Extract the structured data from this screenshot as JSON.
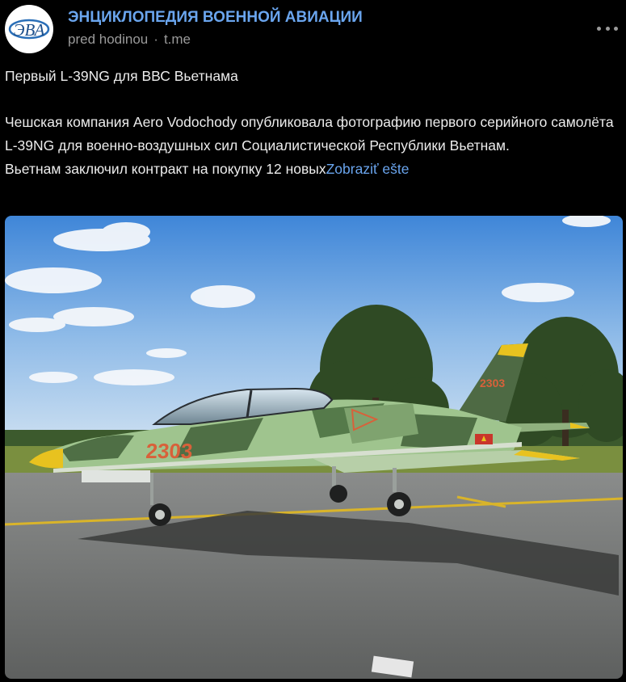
{
  "channel": {
    "name": "ЭНЦИКЛОПЕДИЯ ВОЕННОЙ АВИАЦИИ",
    "time": "pred hodinou",
    "separator": "·",
    "source": "t.me",
    "avatar_text": "ЭВА"
  },
  "post": {
    "title": "Первый L-39NG для ВВС Вьетнама",
    "body": "Чешская компания Aero Vodochody опубликовала фотографию первого серийного самолёта L-39NG для военно-воздушных сил Социалистической Республики Вьетнам.",
    "teaser": "Вьетнам заключил контракт на покупку 12 новых",
    "more_link": "Zobraziť ešte"
  },
  "photo": {
    "tail_number": "2303",
    "fin_number": "2303"
  },
  "icons": [
    "more-options-icon"
  ]
}
